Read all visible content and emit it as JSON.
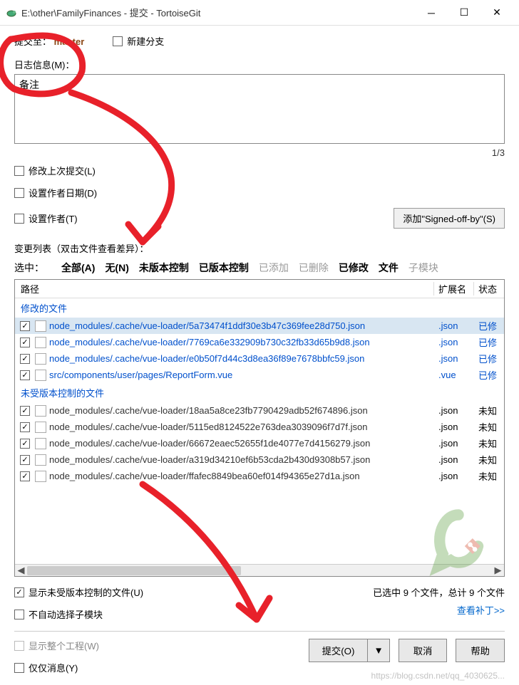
{
  "window": {
    "title": "E:\\other\\FamilyFinances - 提交 - TortoiseGit"
  },
  "commit_to": {
    "label": "提交至：",
    "branch": "master",
    "new_branch_label": "新建分支"
  },
  "log": {
    "section_label": "日志信息(M)：",
    "message_text": "备注",
    "char_count": "1/3",
    "amend_label": "修改上次提交(L)",
    "set_author_date_label": "设置作者日期(D)",
    "set_author_label": "设置作者(T)",
    "signed_off_button": "添加\"Signed-off-by\"(S)"
  },
  "changes": {
    "label": "变更列表（双击文件查看差异）：",
    "selected_label": "选中：",
    "filters": {
      "all": "全部(A)",
      "none": "无(N)",
      "unversioned": "未版本控制",
      "versioned": "已版本控制",
      "added": "已添加",
      "deleted": "已删除",
      "modified": "已修改",
      "files": "文件",
      "submodules": "子模块"
    },
    "headers": {
      "path": "路径",
      "ext": "扩展名",
      "status": "状态"
    },
    "group_modified": "修改的文件",
    "group_unversioned": "未受版本控制的文件",
    "modified_files": [
      {
        "path": "node_modules/.cache/vue-loader/5a73474f1ddf30e3b47c369fee28d750.json",
        "ext": ".json",
        "status": "已修"
      },
      {
        "path": "node_modules/.cache/vue-loader/7769ca6e332909b730c32fb33d65b9d8.json",
        "ext": ".json",
        "status": "已修"
      },
      {
        "path": "node_modules/.cache/vue-loader/e0b50f7d44c3d8ea36f89e7678bbfc59.json",
        "ext": ".json",
        "status": "已修"
      },
      {
        "path": "src/components/user/pages/ReportForm.vue",
        "ext": ".vue",
        "status": "已修"
      }
    ],
    "unversioned_files": [
      {
        "path": "node_modules/.cache/vue-loader/18aa5a8ce23fb7790429adb52f674896.json",
        "ext": ".json",
        "status": "未知"
      },
      {
        "path": "node_modules/.cache/vue-loader/5115ed8124522e763dea3039096f7d7f.json",
        "ext": ".json",
        "status": "未知"
      },
      {
        "path": "node_modules/.cache/vue-loader/66672eaec52655f1de4077e7d4156279.json",
        "ext": ".json",
        "status": "未知"
      },
      {
        "path": "node_modules/.cache/vue-loader/a319d34210ef6b53cda2b430d9308b57.json",
        "ext": ".json",
        "status": "未知"
      },
      {
        "path": "node_modules/.cache/vue-loader/ffafec8849bea60ef014f94365e27d1a.json",
        "ext": ".json",
        "status": "未知"
      }
    ],
    "summary": "已选中 9 个文件，总计 9 个文件",
    "show_unversioned_label": "显示未受版本控制的文件(U)",
    "no_auto_select_submod_label": "不自动选择子模块",
    "view_patch": "查看补丁>>"
  },
  "bottom": {
    "show_whole_project": "显示整个工程(W)",
    "message_only": "仅仅消息(Y)",
    "commit_button": "提交(O)",
    "cancel_button": "取消",
    "help_button": "帮助"
  },
  "watermark": "https://blog.csdn.net/qq_4030625..."
}
